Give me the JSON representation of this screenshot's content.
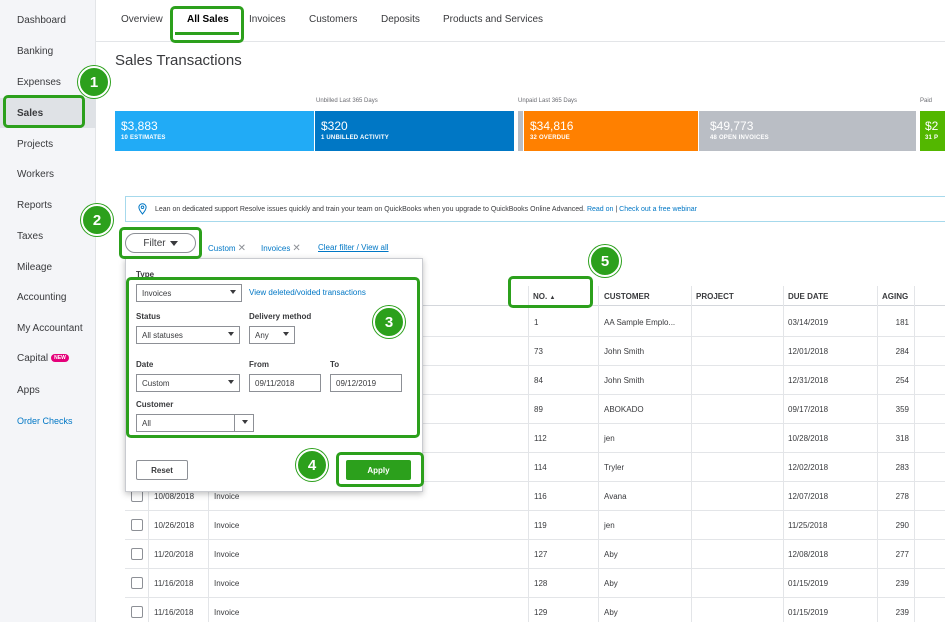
{
  "sidebar": {
    "items": [
      "Dashboard",
      "Banking",
      "Expenses",
      "Sales",
      "Projects",
      "Workers",
      "Reports",
      "Taxes",
      "Mileage",
      "Accounting",
      "My Accountant",
      "Capital",
      "Apps"
    ],
    "capital_badge": "NEW",
    "order_checks": "Order Checks"
  },
  "tabs": [
    "Overview",
    "All Sales",
    "Invoices",
    "Customers",
    "Deposits",
    "Products and Services"
  ],
  "page_title": "Sales Transactions",
  "money_bar": {
    "unbilled_label": "Unbilled Last 365 Days",
    "unpaid_label": "Unpaid Last 365 Days",
    "paid_label": "Paid",
    "estimates": {
      "value": "$3,883",
      "sub": "10 ESTIMATES",
      "color": "#21abf6"
    },
    "unbilled": {
      "value": "$320",
      "sub": "1 UNBILLED ACTIVITY",
      "color": "#0077c5"
    },
    "overdue": {
      "value": "$34,816",
      "sub": "32 OVERDUE",
      "color": "#ff8000"
    },
    "open": {
      "value": "$49,773",
      "sub": "48 OPEN INVOICES",
      "color": "#babec5"
    },
    "paid": {
      "value": "$2",
      "sub": "31 P",
      "color": "#53b700"
    }
  },
  "banner": {
    "lead": "Lean on dedicated support",
    "text": "Resolve issues quickly and train your team on QuickBooks when you upgrade to QuickBooks Online Advanced.",
    "read_on": "Read on",
    "separator": "|",
    "webinar": "Check out a free webinar"
  },
  "filter": {
    "button": "Filter",
    "chip_custom": "Custom",
    "chip_invoices": "Invoices",
    "clear": "Clear filter / View all"
  },
  "panel": {
    "type_label": "Type",
    "type_value": "Invoices",
    "voided_link": "View deleted/voided transactions",
    "status_label": "Status",
    "status_value": "All statuses",
    "delivery_label": "Delivery method",
    "delivery_value": "Any",
    "date_label": "Date",
    "date_value": "Custom",
    "from_label": "From",
    "from_value": "09/11/2018",
    "to_label": "To",
    "to_value": "09/12/2019",
    "customer_label": "Customer",
    "customer_value": "All",
    "reset": "Reset",
    "apply": "Apply"
  },
  "table": {
    "headers": {
      "no": "NO.",
      "no_sort": "▲",
      "customer": "CUSTOMER",
      "project": "PROJECT",
      "due_date": "DUE DATE",
      "aging": "AGING"
    },
    "rows": [
      {
        "date": "",
        "type": "",
        "no": "1",
        "customer": "AA Sample Emplo...",
        "due": "03/14/2019",
        "aging": "181"
      },
      {
        "date": "",
        "type": "",
        "no": "73",
        "customer": "John Smith",
        "due": "12/01/2018",
        "aging": "284"
      },
      {
        "date": "",
        "type": "",
        "no": "84",
        "customer": "John Smith",
        "due": "12/31/2018",
        "aging": "254"
      },
      {
        "date": "",
        "type": "",
        "no": "89",
        "customer": "ABOKADO",
        "due": "09/17/2018",
        "aging": "359"
      },
      {
        "date": "",
        "type": "",
        "no": "112",
        "customer": "jen",
        "due": "10/28/2018",
        "aging": "318"
      },
      {
        "date": "",
        "type": "",
        "no": "114",
        "customer": "Tryler",
        "due": "12/02/2018",
        "aging": "283"
      },
      {
        "date": "10/08/2018",
        "type": "Invoice",
        "no": "116",
        "customer": "Avana",
        "due": "12/07/2018",
        "aging": "278"
      },
      {
        "date": "10/26/2018",
        "type": "Invoice",
        "no": "119",
        "customer": "jen",
        "due": "11/25/2018",
        "aging": "290"
      },
      {
        "date": "11/20/2018",
        "type": "Invoice",
        "no": "127",
        "customer": "Aby",
        "due": "12/08/2018",
        "aging": "277"
      },
      {
        "date": "11/16/2018",
        "type": "Invoice",
        "no": "128",
        "customer": "Aby",
        "due": "01/15/2019",
        "aging": "239"
      },
      {
        "date": "11/16/2018",
        "type": "Invoice",
        "no": "129",
        "customer": "Aby",
        "due": "01/15/2019",
        "aging": "239"
      }
    ]
  },
  "annotations": [
    "1",
    "2",
    "3",
    "4",
    "5"
  ]
}
